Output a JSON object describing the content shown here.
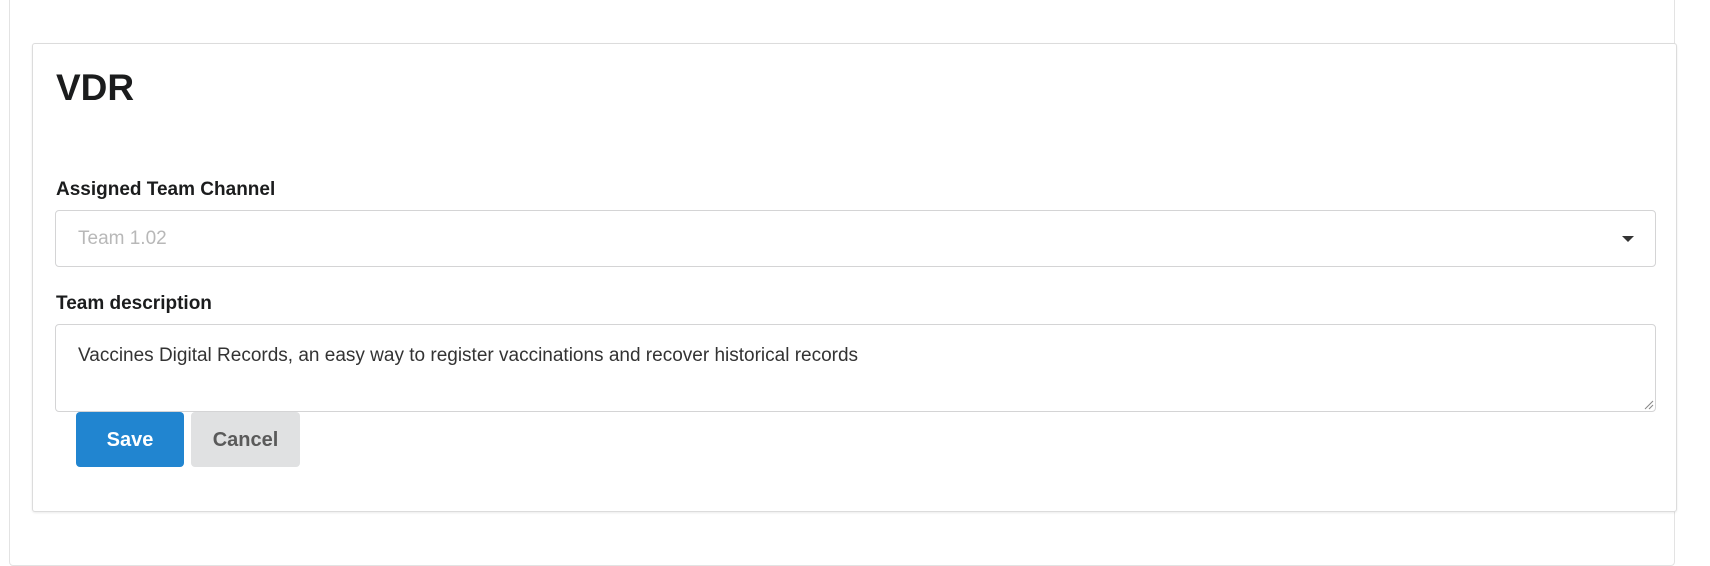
{
  "card": {
    "title": "VDR"
  },
  "form": {
    "channel_label": "Assigned Team Channel",
    "channel_value": "Team 1.02",
    "description_label": "Team description",
    "description_value": "Vaccines Digital Records, an easy way to register vaccinations and recover historical records"
  },
  "actions": {
    "save_label": "Save",
    "cancel_label": "Cancel"
  },
  "colors": {
    "primary": "#2185d0",
    "secondary": "#e0e1e2",
    "placeholder_text": "#b8b8b8"
  },
  "icons": {
    "dropdown": "caret-down-icon",
    "resize": "resize-handle-icon"
  }
}
